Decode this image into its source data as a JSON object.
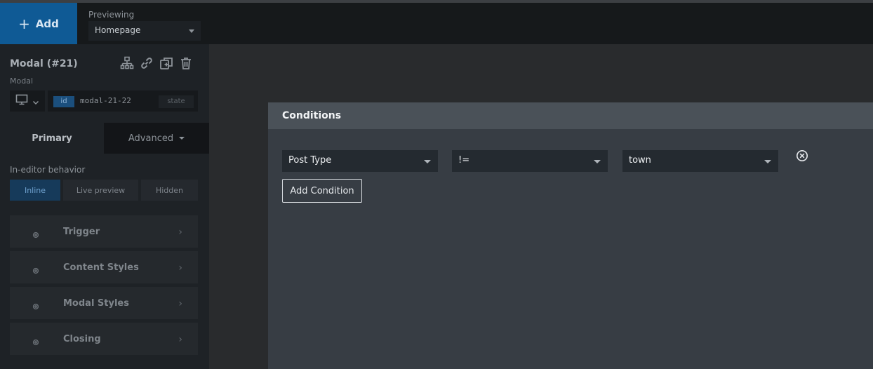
{
  "topbar": {
    "add_label": "Add",
    "previewing_label": "Previewing",
    "previewing_value": "Homepage"
  },
  "sidebar": {
    "element_title": "Modal (#21)",
    "element_type": "Modal",
    "id_badge": "id",
    "id_value": "modal-21-22",
    "state_label": "state",
    "tabs": {
      "primary": "Primary",
      "advanced": "Advanced"
    },
    "behavior": {
      "label": "In-editor behavior",
      "options": [
        "Inline",
        "Live preview",
        "Hidden"
      ],
      "selected": "Inline"
    },
    "sections": [
      "Trigger",
      "Content Styles",
      "Modal Styles",
      "Closing"
    ]
  },
  "modal": {
    "title": "Conditions",
    "condition": {
      "field": "Post Type",
      "operator": "!=",
      "value": "town"
    },
    "add_condition_label": "Add Condition"
  },
  "colors": {
    "accent": "#0f5a95",
    "modal_bg": "#373d44",
    "modal_header": "#4a5158"
  }
}
